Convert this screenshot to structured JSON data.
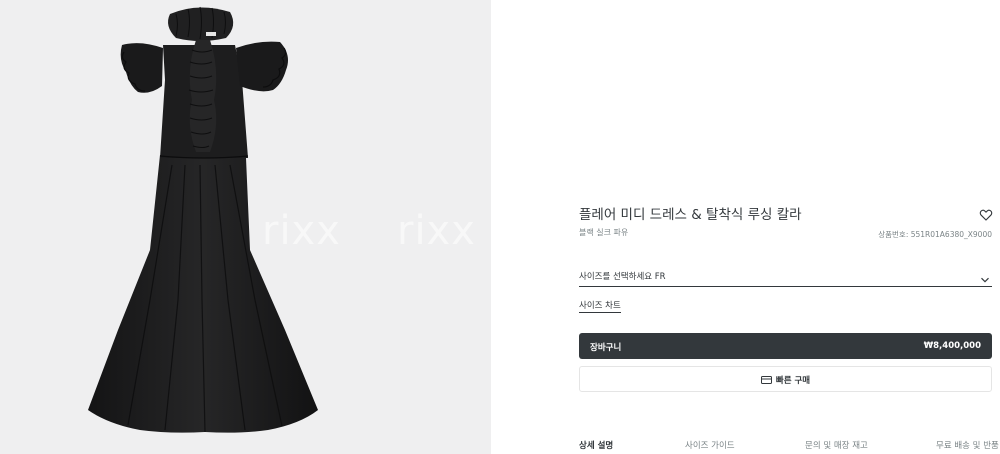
{
  "product": {
    "title": "플레어 미디 드레스 & 탈착식 루싱 칼라",
    "subtitle": "블랙 실크 파유",
    "reference": "상품번호: 551R01A6380_X9000"
  },
  "size_selector": {
    "label": "사이즈를 선택하세요 FR"
  },
  "size_chart_link": "사이즈 차트",
  "cart": {
    "label": "장바구니",
    "price": "₩8,400,000"
  },
  "quick_buy": {
    "label": "빠른 구매"
  },
  "tabs": [
    {
      "label": "상세 설명",
      "active": true
    },
    {
      "label": "사이즈 가이드",
      "active": false
    },
    {
      "label": "문의 및 매장 재고",
      "active": false
    },
    {
      "label": "무료 배송 및 반품",
      "active": false
    }
  ],
  "watermarks": [
    "rixx",
    "rixx",
    "rixx",
    "rixx"
  ],
  "icons": {
    "wishlist": "heart-outline-icon",
    "dropdown": "chevron-down-icon",
    "quick_buy": "credit-card-icon"
  },
  "colors": {
    "ink": "#33383c",
    "muted": "#7b8487",
    "gallery_bg": "#efeff0",
    "dress": "#1c1c1d"
  }
}
